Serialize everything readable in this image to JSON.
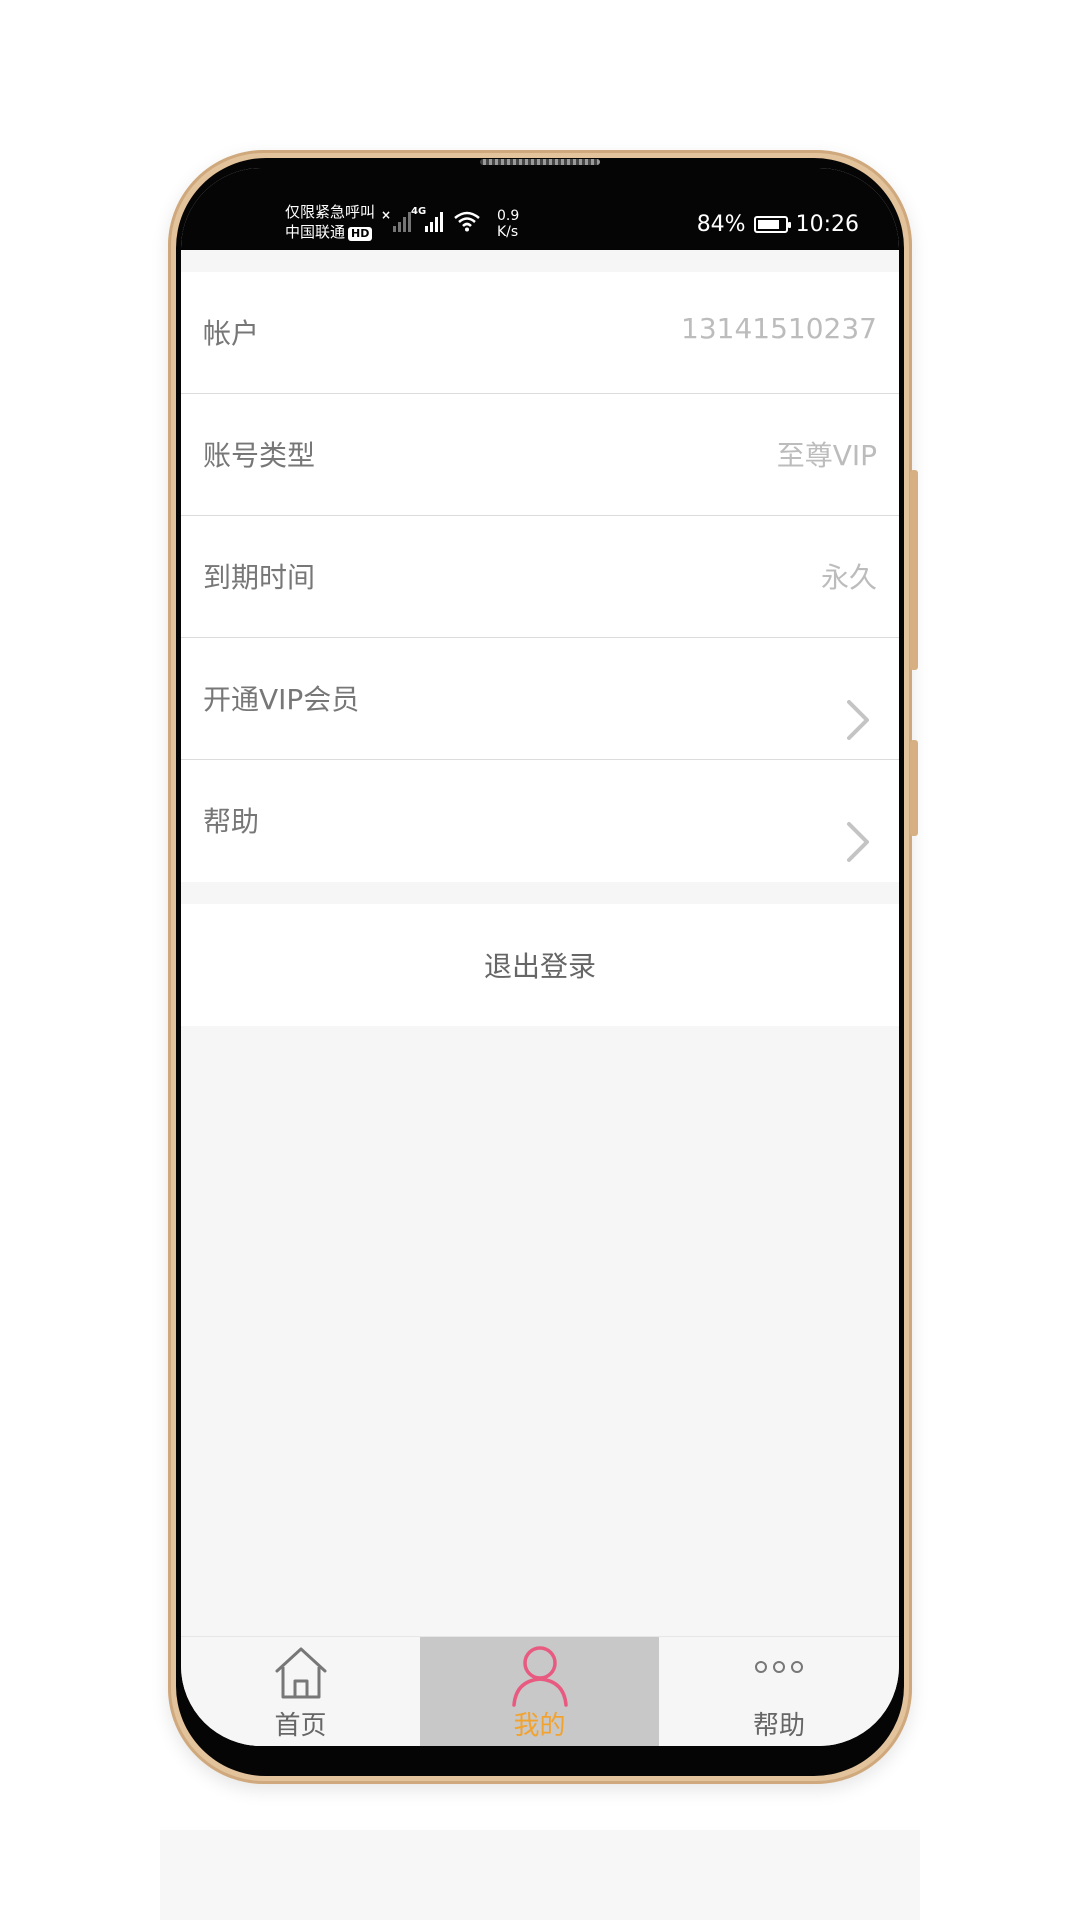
{
  "status_bar": {
    "carrier_line1": "仅限紧急呼叫",
    "carrier_line2": "中国联通",
    "hd": "HD",
    "network": "4G",
    "speed_value": "0.9",
    "speed_unit": "K/s",
    "battery": "84%",
    "battery_level": 0.84,
    "time": "10:26"
  },
  "account": {
    "rows": [
      {
        "label": "帐户",
        "value": "13141510237"
      },
      {
        "label": "账号类型",
        "value": "至尊VIP"
      },
      {
        "label": "到期时间",
        "value": "永久"
      },
      {
        "label": "开通VIP会员"
      },
      {
        "label": "帮助"
      }
    ]
  },
  "logout_label": "退出登录",
  "tabs": [
    {
      "label": "首页",
      "icon": "home-icon"
    },
    {
      "label": "我的",
      "icon": "user-icon",
      "active": true
    },
    {
      "label": "帮助",
      "icon": "more-dots-icon"
    }
  ],
  "colors": {
    "active_tab_label": "#f2a22e",
    "active_tab_icon": "#e85a80",
    "active_tab_bg": "#c8c8c8"
  }
}
